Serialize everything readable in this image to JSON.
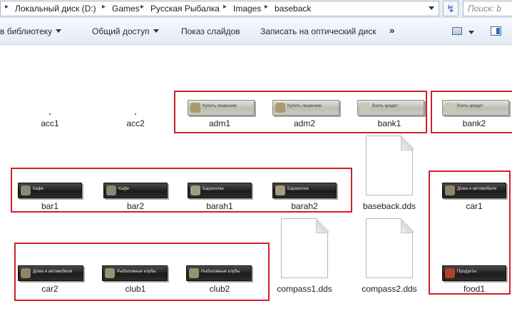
{
  "address_bar": {
    "crumbs": [
      "Локальный диск (D:)",
      "Games",
      "Русская Рыбалка",
      "Images",
      "baseback"
    ],
    "separator": "▸",
    "search_placeholder": "Поиск: b"
  },
  "toolbar": {
    "library_label": "в библиотеку",
    "share_label": "Общий доступ",
    "slideshow_label": "Показ слайдов",
    "burn_label": "Записать на оптический диск",
    "more_label": "»"
  },
  "files": {
    "acc1": "acc1",
    "acc2": "acc2",
    "adm1": "adm1",
    "adm2": "adm2",
    "bank1": "bank1",
    "bank2": "bank2",
    "bar1": "bar1",
    "bar2": "bar2",
    "barah1": "barah1",
    "barah2": "barah2",
    "baseback": "baseback.dds",
    "car1": "car1",
    "car2": "car2",
    "club1": "club1",
    "club2": "club2",
    "compass1": "compass1.dds",
    "compass2": "compass2.dds",
    "food1": "food1"
  },
  "thumb_text": {
    "adm1": "Купить лицензию",
    "adm2": "Купить лицензию",
    "bank1": "Взять кредит",
    "bank2": "Взять кредит",
    "bar1": "Кафе",
    "bar2": "Кафе",
    "barah1": "Барахолка",
    "barah2": "Барахолка",
    "car1": "Дома и автомобили",
    "car2": "Дома и автомобили",
    "club1": "Рыболовные клубы",
    "club2": "Рыболовные клубы",
    "food1": "Продукты"
  },
  "colors": {
    "annotation": "#d0202a",
    "toolbar_bg": "#e3ebf5"
  }
}
